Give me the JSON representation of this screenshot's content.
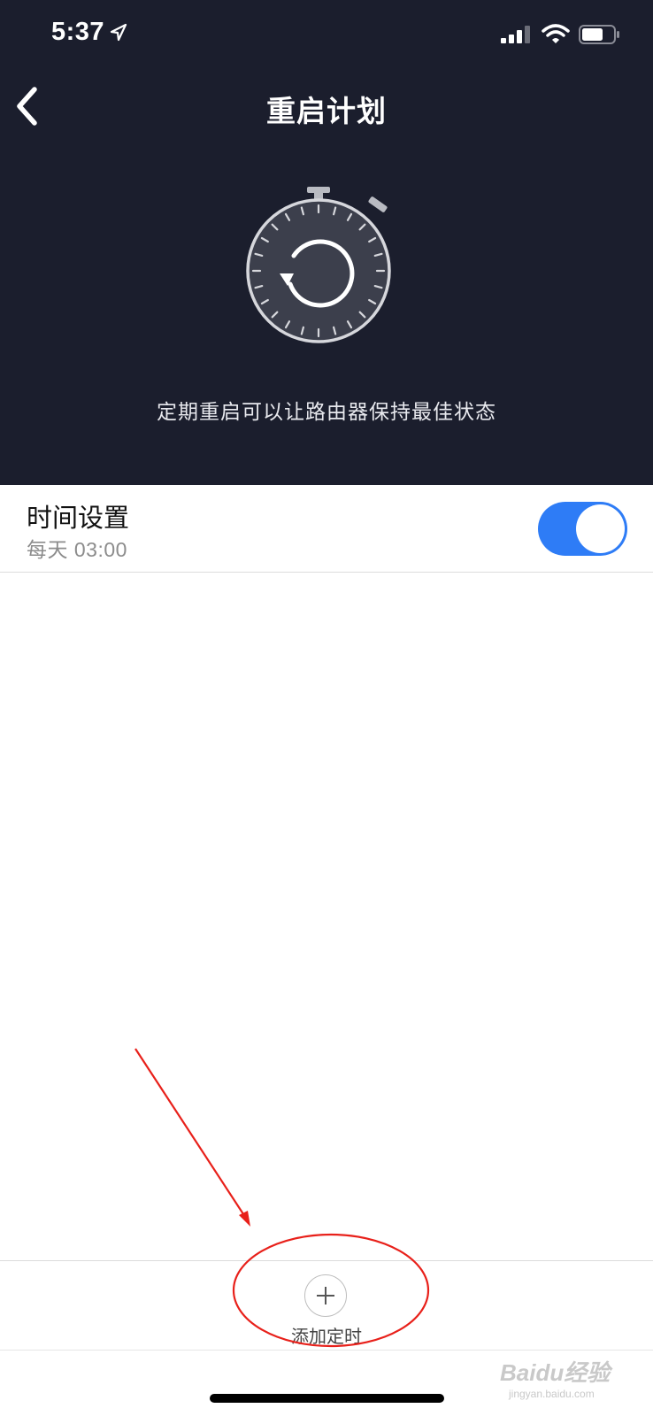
{
  "status_bar": {
    "time": "5:37",
    "icons": [
      "location-arrow-icon",
      "signal-icon",
      "wifi-icon",
      "battery-icon"
    ]
  },
  "nav": {
    "back_icon": "chevron-left-icon",
    "title": "重启计划"
  },
  "hero": {
    "icon": "stopwatch-restart-icon",
    "description": "定期重启可以让路由器保持最佳状态"
  },
  "schedule": {
    "title": "时间设置",
    "subtitle": "每天 03:00",
    "enabled": true
  },
  "add_timer": {
    "icon": "plus-icon",
    "label": "添加定时"
  },
  "watermark": {
    "brand": "Baidu经验",
    "url": "jingyan.baidu.com"
  },
  "colors": {
    "header_bg": "#1b1e2d",
    "toggle_on": "#2e7cf6",
    "annotation": "#e8201a"
  }
}
